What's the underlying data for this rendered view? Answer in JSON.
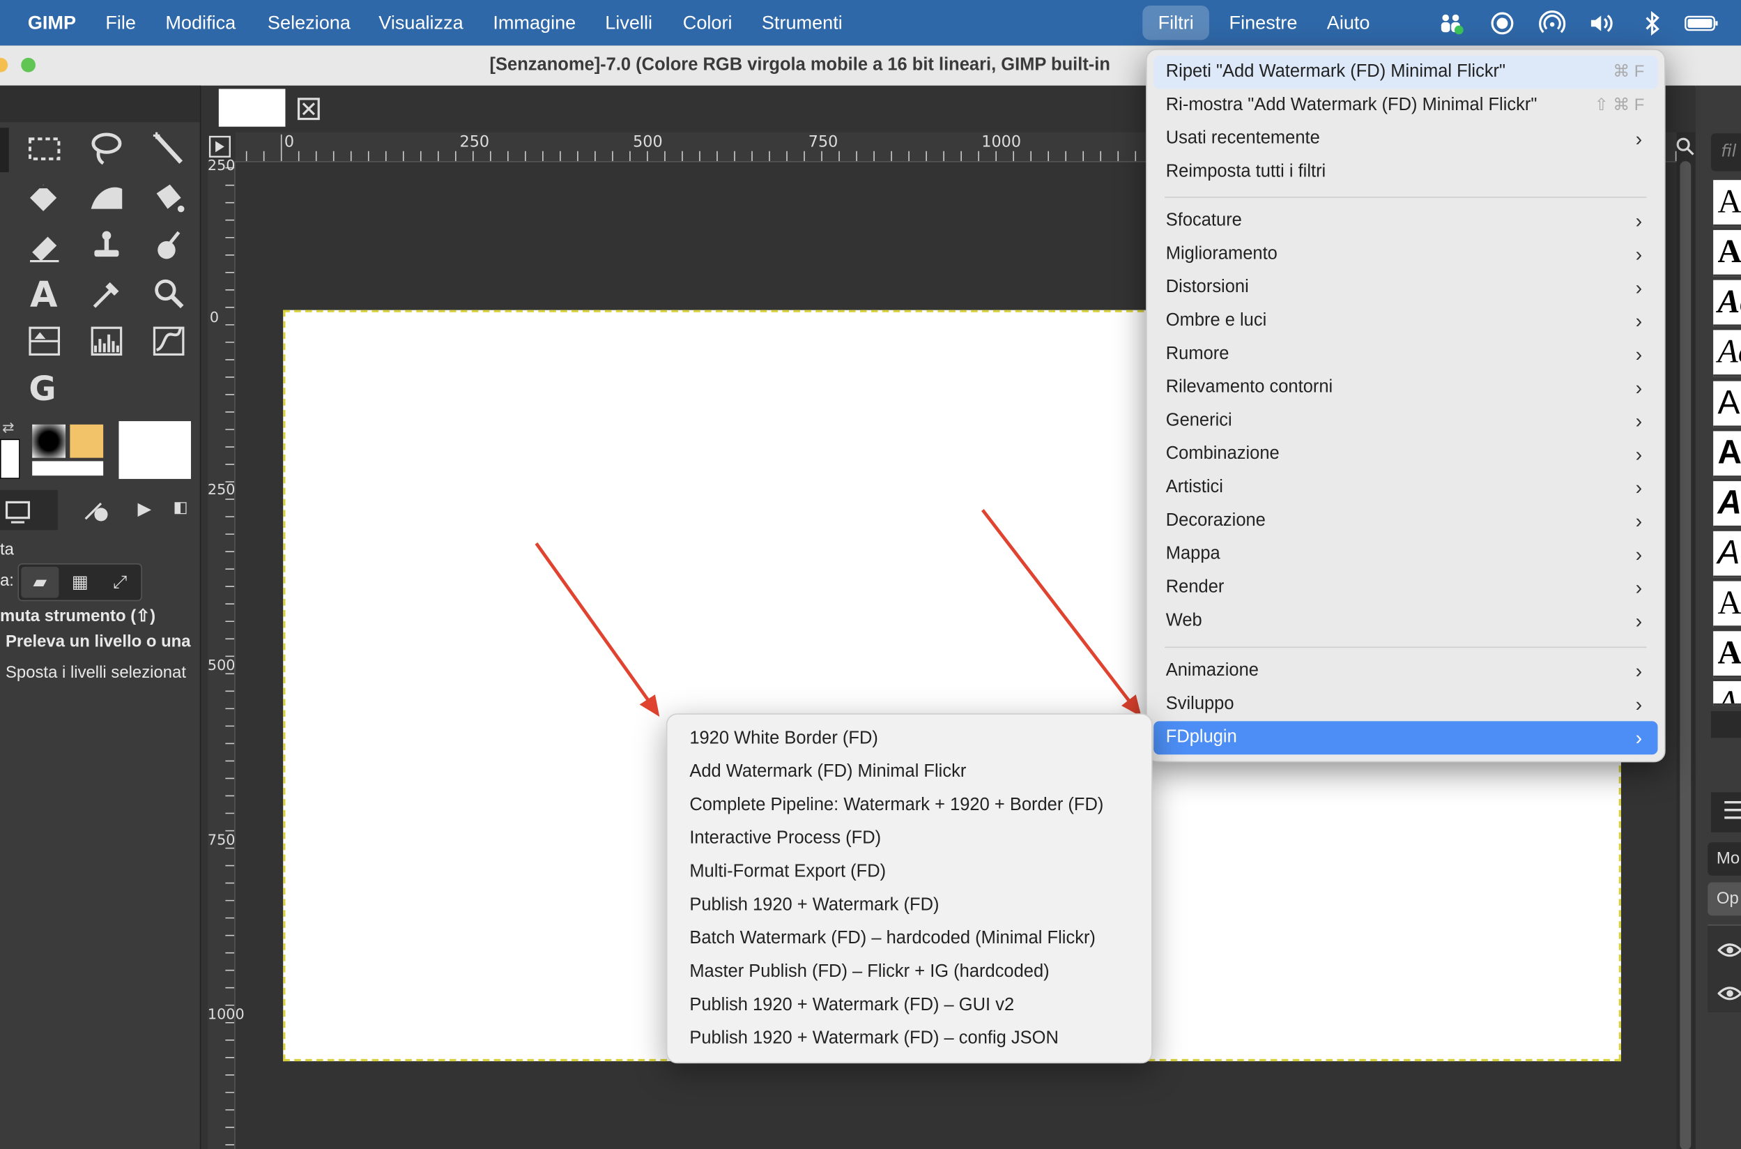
{
  "menubar": {
    "app": "GIMP",
    "items": [
      "File",
      "Modifica",
      "Seleziona",
      "Visualizza",
      "Immagine",
      "Livelli",
      "Colori",
      "Strumenti",
      "Filtri",
      "Finestre",
      "Aiuto"
    ]
  },
  "window": {
    "title": "[Senzanome]-7.0 (Colore RGB virgola mobile a 16 bit lineari, GIMP built-in"
  },
  "rulers": {
    "horizontal": [
      "0",
      "250",
      "500",
      "750",
      "1000"
    ],
    "vertical": [
      "250",
      "0",
      "250",
      "500",
      "750",
      "1000"
    ]
  },
  "tool_options": {
    "title_fragment": "ta",
    "mode_label": "a:",
    "toggle_label": "muta strumento (⇧)",
    "option1": "Preleva un livello o una",
    "option2": "Sposta i livelli selezionat"
  },
  "filters_menu": {
    "repeat": {
      "label": "Ripeti \"Add Watermark (FD) Minimal Flickr\"",
      "shortcut": "⌘ F"
    },
    "reshow": {
      "label": "Ri-mostra \"Add Watermark (FD) Minimal Flickr\"",
      "shortcut": "⇧ ⌘ F"
    },
    "recent": "Usati recentemente",
    "reset": "Reimposta tutti i filtri",
    "group1": [
      "Sfocature",
      "Miglioramento",
      "Distorsioni",
      "Ombre e luci",
      "Rumore",
      "Rilevamento contorni",
      "Generici",
      "Combinazione",
      "Artistici",
      "Decorazione",
      "Mappa",
      "Render",
      "Web"
    ],
    "group2": [
      "Animazione",
      "Sviluppo",
      "FDplugin"
    ]
  },
  "fdplugin_menu": {
    "items": [
      "1920 White Border (FD)",
      "Add Watermark (FD) Minimal Flickr",
      "Complete Pipeline: Watermark + 1920 + Border (FD)",
      "Interactive Process (FD)",
      "Multi-Format Export (FD)",
      "Publish 1920 + Watermark (FD)",
      "Batch Watermark (FD) – hardcoded (Minimal Flickr)",
      "Master Publish (FD) – Flickr + IG (hardcoded)",
      "Publish 1920 + Watermark (FD) – GUI v2",
      "Publish 1920 + Watermark (FD) – config JSON"
    ]
  },
  "right_panel": {
    "filter_placeholder": "fil",
    "font_previews": [
      "Ac",
      "Ac",
      "Ac",
      "Ac",
      "Ac",
      "Aa",
      "Ac",
      "Ac",
      "A",
      "A",
      "A"
    ],
    "mode_label": "Mo",
    "opacity_label": "Op"
  },
  "colors": {
    "menubar": "#2f68a8",
    "highlight": "#4c8ef5",
    "arrow": "#e0432f",
    "canvas_border": "#d8d140"
  }
}
